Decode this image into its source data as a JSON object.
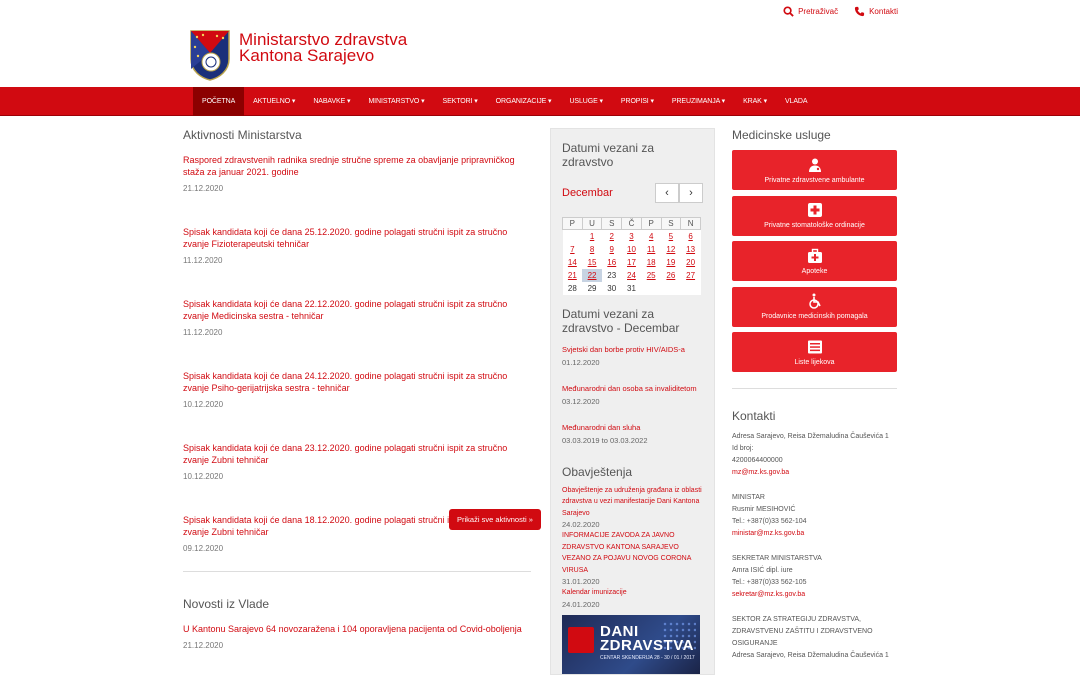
{
  "topbar": {
    "search_label": "Pretraživač",
    "contact_label": "Kontakti"
  },
  "brand": {
    "line1": "Ministarstvo zdravstva",
    "line2": "Kantona Sarajevo"
  },
  "nav": [
    "POČETNA",
    "AKTUELNO ▾",
    "NABAVKE ▾",
    "MINISTARSTVO ▾",
    "SEKTORI ▾",
    "ORGANIZACIJE ▾",
    "USLUGE ▾",
    "PROPISI ▾",
    "PREUZIMANJA ▾",
    "KRAK ▾",
    "VLADA"
  ],
  "activities": {
    "title": "Aktivnosti Ministarstva",
    "items": [
      {
        "text": "Raspored zdravstvenih radnika srednje stručne spreme za obavljanje pripravničkog staža za januar 2021. godine",
        "date": "21.12.2020"
      },
      {
        "text": "Spisak kandidata koji će dana 25.12.2020. godine polagati stručni ispit za stručno zvanje Fizioterapeutski tehničar",
        "date": "11.12.2020"
      },
      {
        "text": "Spisak kandidata koji će dana 22.12.2020. godine polagati stručni ispit za stručno zvanje Medicinska sestra - tehničar",
        "date": "11.12.2020"
      },
      {
        "text": "Spisak kandidata koji će dana 24.12.2020. godine polagati stručni ispit za stručno zvanje Psiho-gerijatrijska sestra - tehničar",
        "date": "10.12.2020"
      },
      {
        "text": "Spisak kandidata koji će dana 23.12.2020. godine polagati stručni ispit za stručno zvanje Zubni tehničar",
        "date": "10.12.2020"
      },
      {
        "text": "Spisak kandidata koji će dana 18.12.2020. godine polagati stručni ispit za stručno zvanje Zubni tehničar",
        "date": "09.12.2020"
      }
    ],
    "more_label": "Prikaži sve aktivnosti »"
  },
  "gov_news": {
    "title": "Novosti iz Vlade",
    "items": [
      {
        "text": "U Kantonu Sarajevo 64 novozaražena i 104 oporavljena pacijenta od Covid-oboljenja",
        "date": "21.12.2020"
      }
    ]
  },
  "calendar": {
    "title": "Datumi vezani za zdravstvo",
    "month": "Decembar",
    "prev": "‹",
    "next": "›",
    "weekdays": [
      "P",
      "U",
      "S",
      "Č",
      "P",
      "S",
      "N"
    ],
    "weeks": [
      [
        "",
        "1",
        "2",
        "3",
        "4",
        "5",
        "6"
      ],
      [
        "7",
        "8",
        "9",
        "10",
        "11",
        "12",
        "13"
      ],
      [
        "14",
        "15",
        "16",
        "17",
        "18",
        "19",
        "20"
      ],
      [
        "21",
        "22",
        "23",
        "24",
        "25",
        "26",
        "27"
      ],
      [
        "28",
        "29",
        "30",
        "31",
        "",
        "",
        ""
      ]
    ],
    "today": "22",
    "plain_days": [
      "23",
      "28",
      "29",
      "30",
      "31"
    ]
  },
  "month_events": {
    "title": "Datumi vezani za zdravstvo - Decembar",
    "items": [
      {
        "text": "Svjetski dan borbe protiv HIV/AIDS-a",
        "date": "01.12.2020"
      },
      {
        "text": "Međunarodni dan osoba sa invaliditetom",
        "date": "03.12.2020"
      },
      {
        "text": "Međunarodni dan sluha",
        "date": "03.03.2019 to 03.03.2022"
      }
    ]
  },
  "notices": {
    "title": "Obavještenja",
    "items": [
      {
        "text": "Obavještenje za udruženja građana iz oblasti zdravstva u vezi manifestacije Dani Kantona Sarajevo",
        "date": "24.02.2020"
      },
      {
        "text": "INFORMACIJE ZAVODA ZA JAVNO ZDRAVSTVO KANTONA SARAJEVO VEZANO ZA POJAVU NOVOG CORONA VIRUSA",
        "date": "31.01.2020"
      },
      {
        "text": "Kalendar imunizacije",
        "date": "24.01.2020"
      }
    ],
    "banner_line1": "DANI",
    "banner_line2": "ZDRAVSTVA",
    "banner_sub": "CENTAR SKENDERIJA 28 - 30 / 01 / 2017"
  },
  "services": {
    "title": "Medicinske usluge",
    "items": [
      {
        "label": "Privatne zdravstvene ambulante",
        "icon": "doctor-icon"
      },
      {
        "label": "Privatne stomatološke ordinacije",
        "icon": "medical-cross-icon"
      },
      {
        "label": "Apoteke",
        "icon": "first-aid-kit-icon"
      },
      {
        "label": "Prodavnice medicinskih pomagala",
        "icon": "wheelchair-icon"
      },
      {
        "label": "Liste lijekova",
        "icon": "list-icon"
      }
    ]
  },
  "contacts": {
    "title": "Kontakti",
    "blocks": [
      {
        "lines": [
          "Adresa Sarajevo, Reisa Džemaludina Čauševića 1",
          "Id broj:",
          "4200064400000"
        ],
        "links": [
          "mz@mz.ks.gov.ba"
        ]
      },
      {
        "lines": [
          "MINISTAR",
          "Rusmir MESIHOVIĆ",
          "Tel.: +387(0)33 562-104"
        ],
        "links": [
          "ministar@mz.ks.gov.ba"
        ]
      },
      {
        "lines": [
          "SEKRETAR MINISTARSTVA",
          "Amra ISIĆ dipl. iure",
          "Tel.: +387(0)33 562-105"
        ],
        "links": [
          "sekretar@mz.ks.gov.ba"
        ]
      },
      {
        "lines": [
          "SEKTOR ZA STRATEGIJU ZDRAVSTVA, ZDRAVSTVENU ZAŠTITU I ZDRAVSTVENO OSIGURANJE",
          "Adresa Sarajevo, Reisa Džemaludina Čauševića 1"
        ],
        "links": []
      }
    ]
  },
  "colors": {
    "brand_red": "#d10a11",
    "nav_active": "#8c0000",
    "service_red": "#e8232a"
  }
}
